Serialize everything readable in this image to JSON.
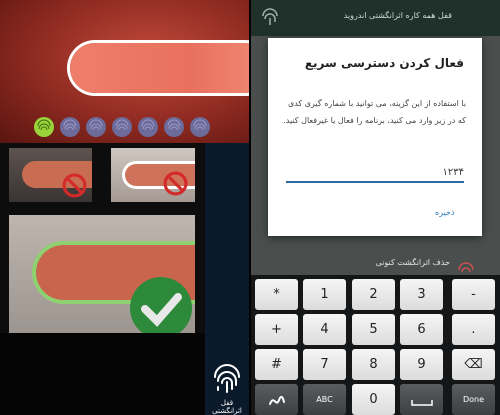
{
  "left_app": {
    "label": "قفل اثرانگشتی"
  },
  "right_app": {
    "appbar_title": "قفل همه کاره اثرانگشتی اندروید",
    "dialog": {
      "title": "فعال کردن دسترسی سریع",
      "body": "با استفاده از این گزینه، می توانید با شماره گیری کدی که در زیر وارد می کنید، برنامه را فعال یا غیرفعال کنید.",
      "input_value": "۱۲۳۴",
      "save_label": "ذخیره"
    },
    "remove_fingerprint_label": "حذف اثرانگشت کنونی"
  },
  "keyboard": {
    "rows": [
      [
        "*",
        "1",
        "2",
        "3",
        "-"
      ],
      [
        "+",
        "4",
        "5",
        "6",
        "."
      ],
      [
        "#",
        "7",
        "8",
        "9",
        "⌫"
      ],
      [
        "ABC",
        "0",
        "Done"
      ]
    ]
  },
  "colors": {
    "accent_blue": "#2d6aa0",
    "check_green": "#2c8a3a",
    "no_red": "#d42a2a"
  }
}
